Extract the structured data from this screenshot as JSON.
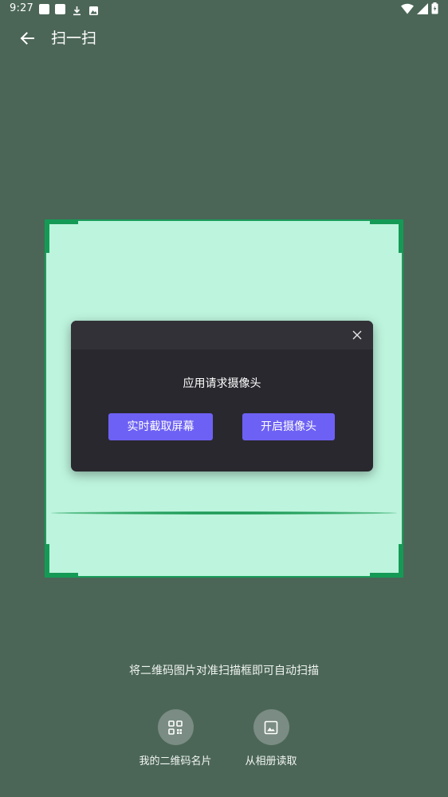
{
  "status_bar": {
    "time": "9:27",
    "icons": [
      "notification-square-icon",
      "notification-square-icon",
      "download-icon",
      "image-icon",
      "wifi-icon",
      "signal-icon",
      "battery-icon"
    ]
  },
  "app_bar": {
    "title": "扫一扫",
    "back_icon": "arrow-left-icon"
  },
  "dialog": {
    "message": "应用请求摄像头",
    "close_icon": "close-icon",
    "capture_button": "实时截取屏幕",
    "camera_button": "开启摄像头",
    "button_color": "#6d61f5"
  },
  "scanner": {
    "hint": "将二维码图片对准扫描框即可自动扫描",
    "frame_color": "#1a9c5a",
    "frame_fill": "#bdf4dd"
  },
  "actions": [
    {
      "label": "我的二维码名片",
      "icon": "qr-code-icon"
    },
    {
      "label": "从相册读取",
      "icon": "image-icon"
    }
  ]
}
